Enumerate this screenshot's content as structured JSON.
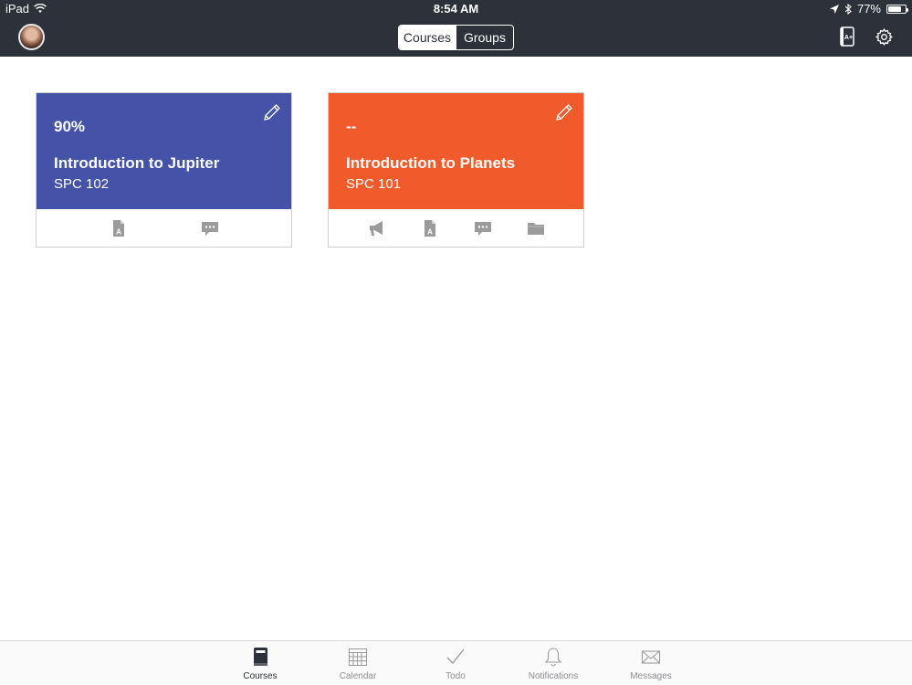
{
  "status": {
    "device": "iPad",
    "time": "8:54 AM",
    "battery": "77%",
    "battery_level": 0.77
  },
  "header": {
    "segments": [
      {
        "label": "Courses",
        "active": true
      },
      {
        "label": "Groups",
        "active": false
      }
    ],
    "grades_icon": "grades-icon",
    "settings_icon": "gear-icon"
  },
  "courses": [
    {
      "grade": "90%",
      "title": "Introduction to Jupiter",
      "code": "SPC 102",
      "color": "#4453a8"
    },
    {
      "grade": "--",
      "title": "Introduction to Planets",
      "code": "SPC 101",
      "color": "#f15a2b"
    }
  ],
  "tabs": [
    {
      "label": "Courses",
      "icon": "book-icon",
      "active": true
    },
    {
      "label": "Calendar",
      "icon": "calendar-icon",
      "active": false
    },
    {
      "label": "Todo",
      "icon": "checkmark-icon",
      "active": false
    },
    {
      "label": "Notifications",
      "icon": "bell-icon",
      "active": false
    },
    {
      "label": "Messages",
      "icon": "envelope-icon",
      "active": false
    }
  ],
  "colors": {
    "topbar": "#2c313a",
    "icon_gray": "#9b9b9b",
    "tab_inactive": "#8e8e93"
  }
}
